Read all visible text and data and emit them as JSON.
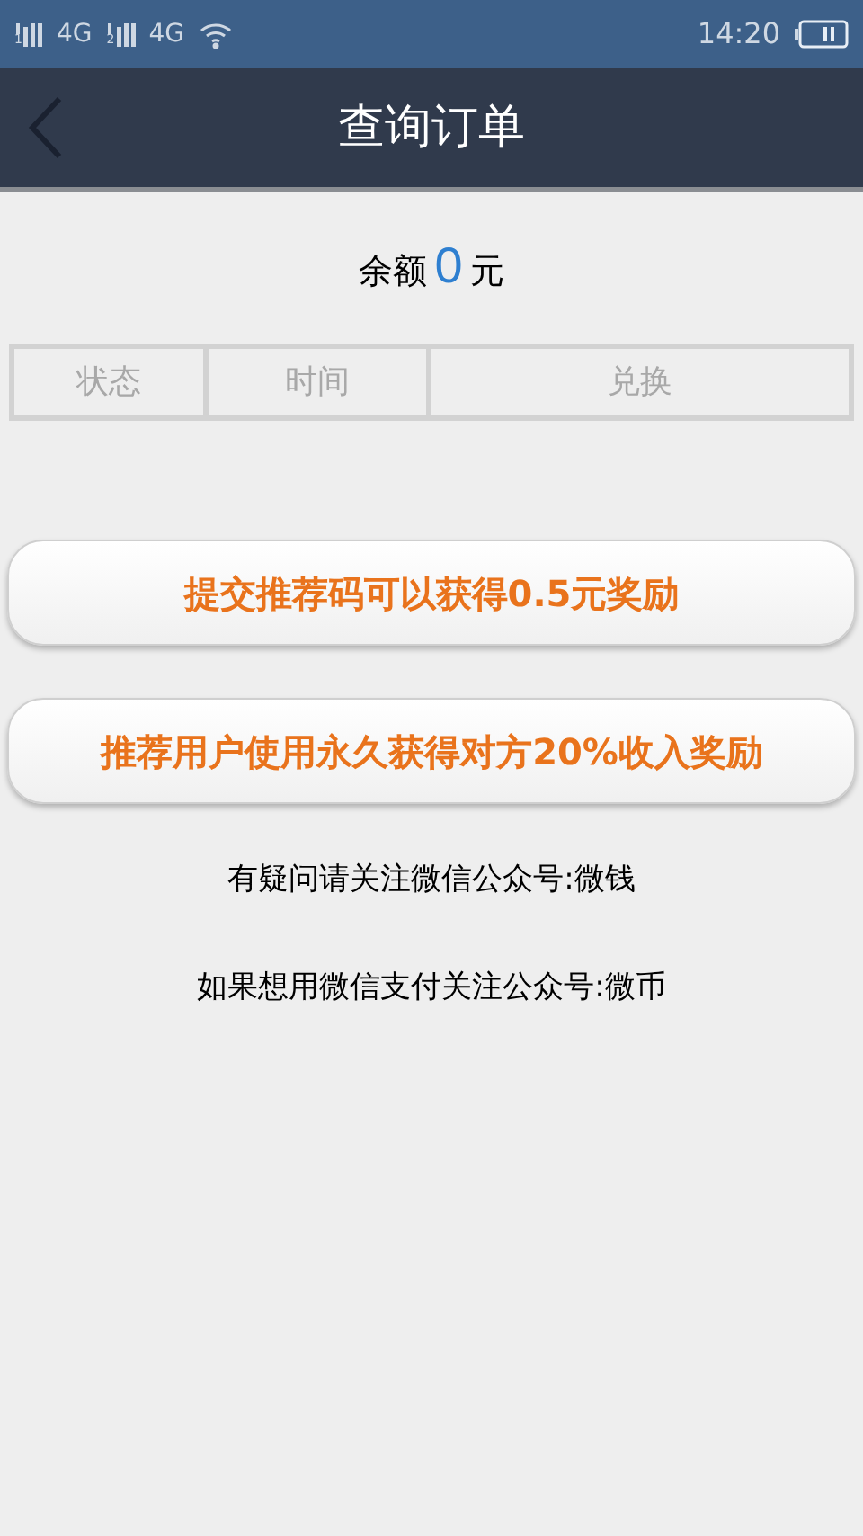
{
  "status_bar": {
    "sims": [
      {
        "index": "1",
        "network": "4G"
      },
      {
        "index": "2",
        "network": "4G"
      }
    ],
    "time": "14:20"
  },
  "header": {
    "title": "查询订单"
  },
  "balance": {
    "label": "余额",
    "amount": "0",
    "unit": "元"
  },
  "table": {
    "columns": [
      "状态",
      "时间",
      "兑换"
    ]
  },
  "buttons": [
    "提交推荐码可以获得0.5元奖励",
    "推荐用户使用永久获得对方20%收入奖励"
  ],
  "notes": [
    "有疑问请关注微信公众号:微钱",
    "如果想用微信支付关注公众号:微币"
  ]
}
